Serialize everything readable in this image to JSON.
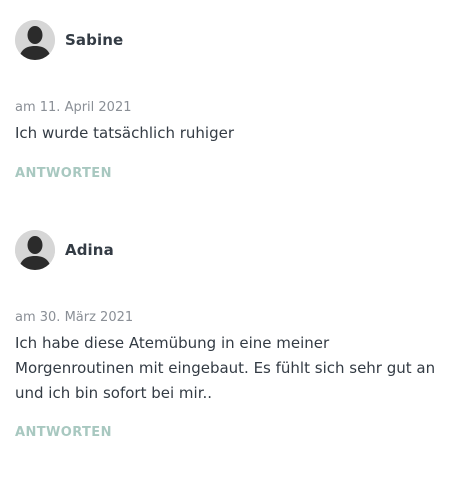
{
  "comments": [
    {
      "author": "Sabine",
      "date": "am 11. April 2021",
      "text": "Ich wurde tatsächlich ruhiger",
      "reply_label": "ANTWORTEN"
    },
    {
      "author": "Adina",
      "date": "am 30. März 2021",
      "text": "Ich habe diese Atemübung in eine meiner Morgenroutinen mit eingebaut. Es fühlt sich sehr gut an und ich bin sofort bei mir..",
      "reply_label": "ANTWORTEN"
    }
  ],
  "icons": {
    "avatar": "default-user-silhouette-icon"
  },
  "colors": {
    "text": "#333b44",
    "date": "#8a8f96",
    "reply_link": "#a8c8c0",
    "avatar_bg": "#d6d6d6",
    "avatar_silhouette": "#2b2b2b"
  }
}
